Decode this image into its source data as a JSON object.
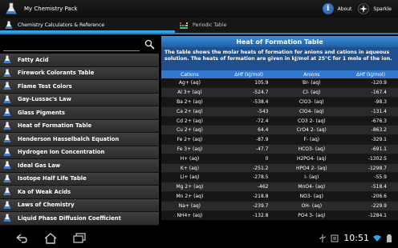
{
  "app": {
    "title": "My Chemistry Pack"
  },
  "actions": {
    "about_label": "About",
    "about_glyph": "i",
    "sparkle_label": "Sparkle"
  },
  "tabs": [
    {
      "label": "Chemistry Calculators & Reference",
      "selected": true
    },
    {
      "label": "Periodic Table",
      "selected": false
    }
  ],
  "search": {
    "value": "",
    "placeholder": ""
  },
  "list": {
    "items": [
      "Fatty Acid",
      "Firework Colorants Table",
      "Flame Test Colors",
      "Gay-Lussac's Law",
      "Glass Pigments",
      "Heat of Formation Table",
      "Henderson Hasselbalch Equation",
      "Hydrogen Ion Concentration",
      "Ideal Gas Law",
      "Isotope Half Life Table",
      "Ka of Weak Acids",
      "Laws of Chemistry",
      "Liquid Phase Diffusion Coefficient"
    ]
  },
  "detail": {
    "title": "Heat of Formation Table",
    "description": "The table shows the molar heats of formation for anions and cations in aqueous solution. The heats of formation are given in kJ/mol at 25°C for 1 mole of the ion.",
    "headers": [
      "Cations",
      "ΔHf (kJ/mol)",
      "Anions",
      "ΔHf (kJ/mol)"
    ],
    "rows": [
      [
        "Ag+ (aq)",
        "105.9",
        "Br- (aq)",
        "-120.9"
      ],
      [
        "Al 3+ (aq)",
        "-524.7",
        "Cl- (aq)",
        "-167.4"
      ],
      [
        "Ba 2+ (aq)",
        "-538.4",
        "ClO3- (aq)",
        "-98.3"
      ],
      [
        "Ca 2+ (aq)",
        "-543",
        "ClO4- (aq)",
        "-131.4"
      ],
      [
        "Cd 2+ (aq)",
        "-72.4",
        "CO3 2- (aq)",
        "-676.3"
      ],
      [
        "Cu 2+ (aq)",
        "64.4",
        "CrO4 2- (aq)",
        "-863.2"
      ],
      [
        "Fe 2+ (aq)",
        "-87.9",
        "F- (aq)",
        "-329.1"
      ],
      [
        "Fe 3+ (aq)",
        "-47.7",
        "HCO3- (aq)",
        "-691.1"
      ],
      [
        "H+ (aq)",
        "0",
        "H2PO4- (aq)",
        "-1302.5"
      ],
      [
        "K+ (aq)",
        "-251.2",
        "HPO4 2- (aq)",
        "-1298.7"
      ],
      [
        "Li+ (aq)",
        "-278.5",
        "I- (aq)",
        "-55.9"
      ],
      [
        "Mg 2+ (aq)",
        "-462",
        "MnO4- (aq)",
        "-518.4"
      ],
      [
        "Mn 2+ (aq)",
        "-218.8",
        "NO3- (aq)",
        "-206.6"
      ],
      [
        "Na+ (aq)",
        "-239.7",
        "OH- (aq)",
        "-229.9"
      ],
      [
        "NH4+ (aq)",
        "-132.8",
        "PO4 3- (aq)",
        "-1284.1"
      ]
    ]
  },
  "system": {
    "clock": "10:51"
  },
  "colors": {
    "accent": "#33a4e5",
    "header_blue": "#2f7ad0",
    "description_blue": "#1f4f8c"
  }
}
